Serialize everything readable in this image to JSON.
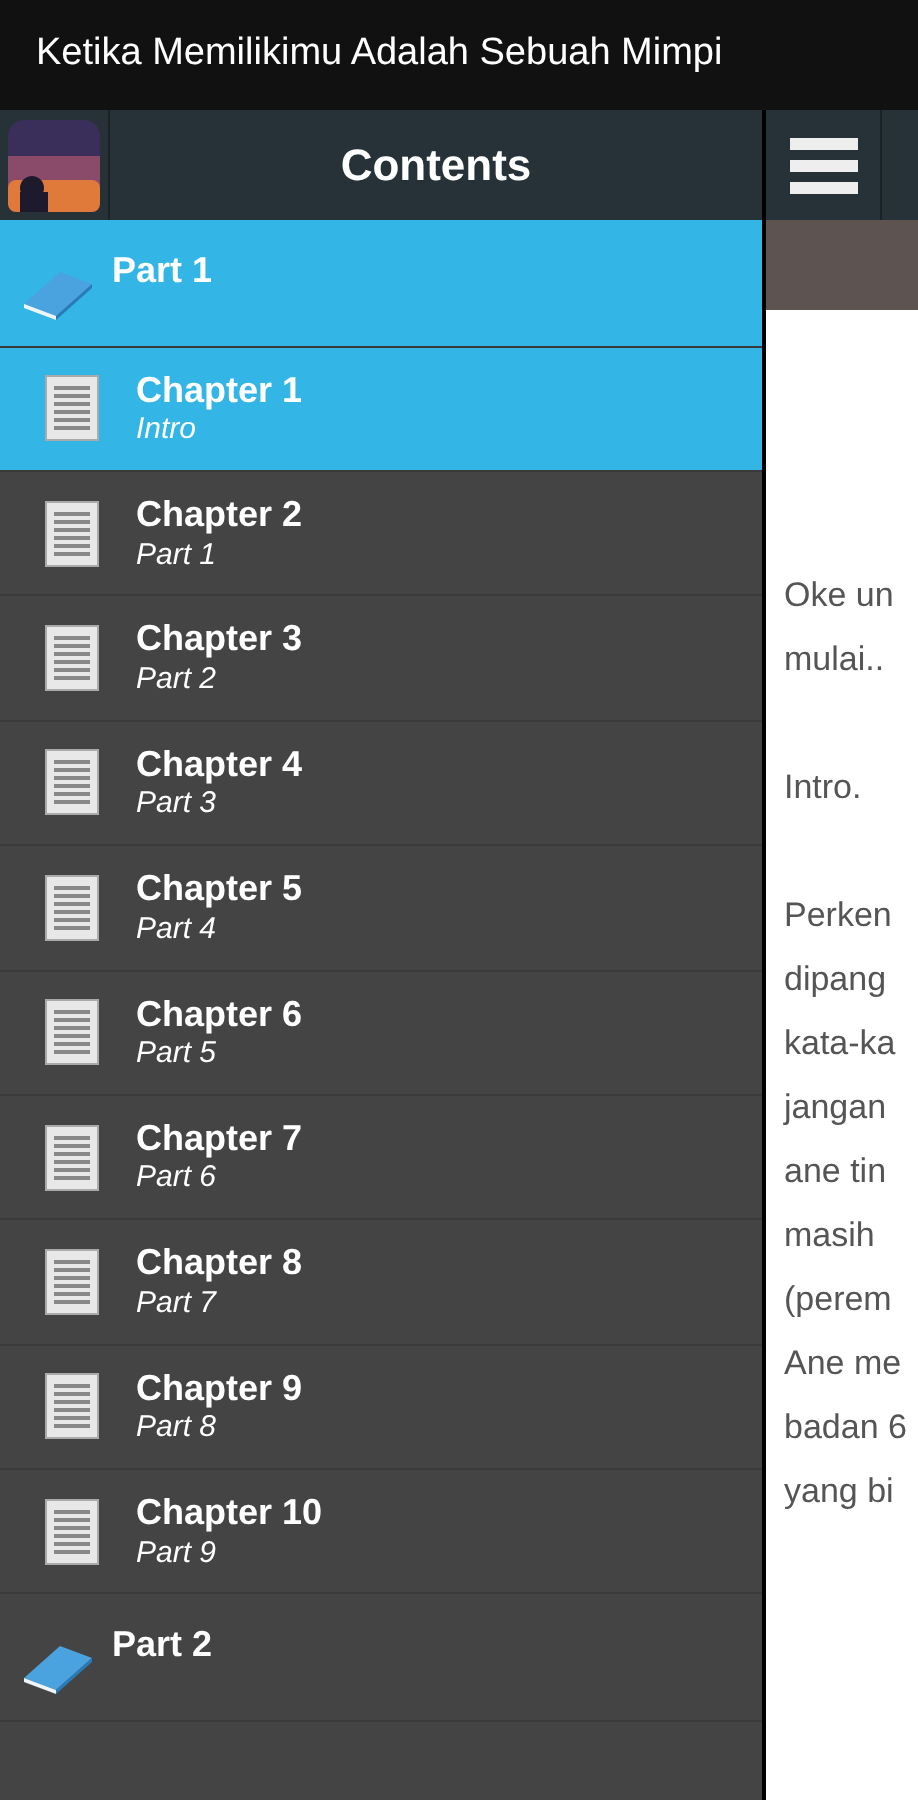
{
  "window": {
    "title": "Ketika Memilikimu Adalah Sebuah Mimpi"
  },
  "drawer": {
    "title": "Contents",
    "items": [
      {
        "kind": "part",
        "title": "Part 1",
        "selected": true
      },
      {
        "kind": "chapter",
        "title": "Chapter 1",
        "subtitle": "Intro",
        "selected": true
      },
      {
        "kind": "chapter",
        "title": "Chapter 2",
        "subtitle": "Part 1",
        "selected": false
      },
      {
        "kind": "chapter",
        "title": "Chapter 3",
        "subtitle": "Part 2",
        "selected": false
      },
      {
        "kind": "chapter",
        "title": "Chapter 4",
        "subtitle": "Part 3",
        "selected": false
      },
      {
        "kind": "chapter",
        "title": "Chapter 5",
        "subtitle": "Part 4",
        "selected": false
      },
      {
        "kind": "chapter",
        "title": "Chapter 6",
        "subtitle": "Part 5",
        "selected": false
      },
      {
        "kind": "chapter",
        "title": "Chapter 7",
        "subtitle": "Part 6",
        "selected": false
      },
      {
        "kind": "chapter",
        "title": "Chapter 8",
        "subtitle": "Part 7",
        "selected": false
      },
      {
        "kind": "chapter",
        "title": "Chapter 9",
        "subtitle": "Part 8",
        "selected": false
      },
      {
        "kind": "chapter",
        "title": "Chapter 10",
        "subtitle": "Part 9",
        "selected": false
      },
      {
        "kind": "part",
        "title": "Part 2",
        "selected": false
      }
    ]
  },
  "reader": {
    "paragraphs": [
      [
        "Oke un",
        "mulai.."
      ],
      [
        "Intro."
      ],
      [
        "Perken",
        "dipang",
        "kata-ka",
        "jangan",
        "ane tin",
        "masih",
        "(perem",
        "Ane me",
        "badan 6",
        "yang bi"
      ]
    ]
  }
}
